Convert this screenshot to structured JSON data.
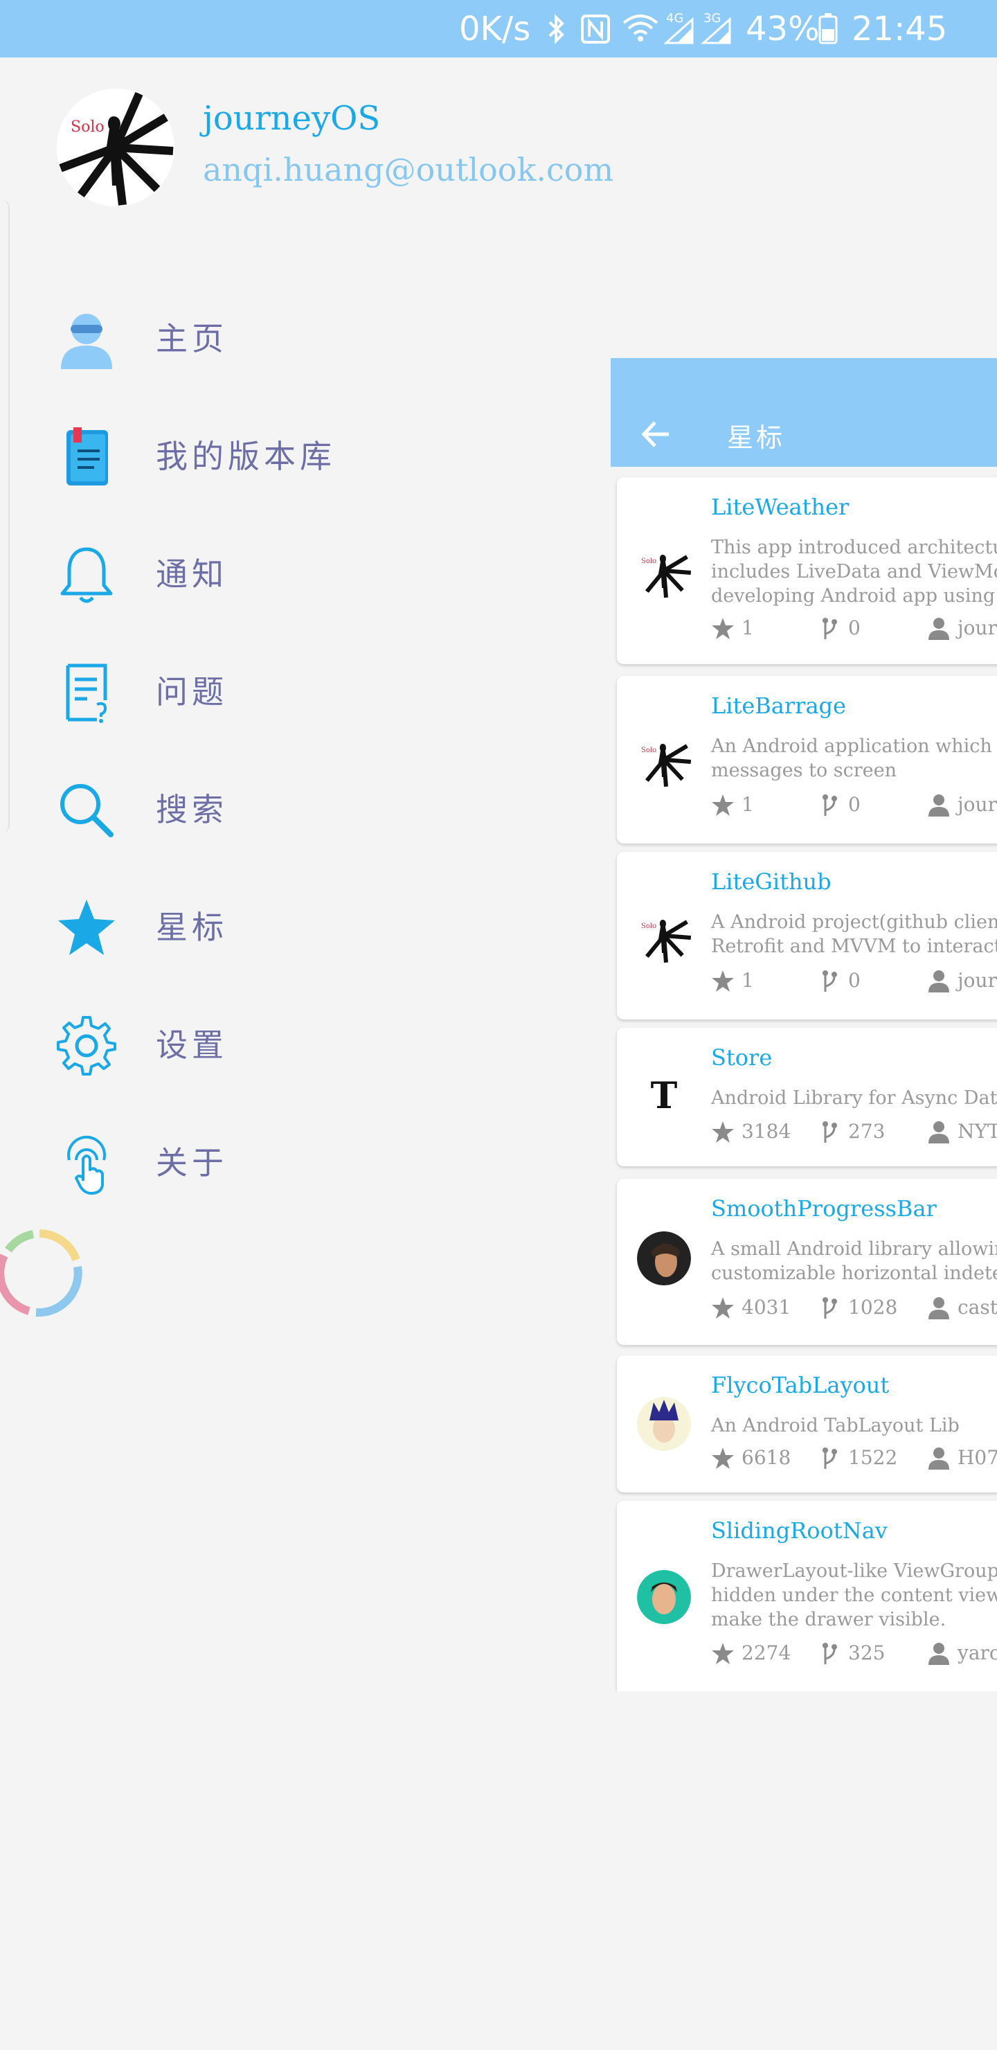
{
  "status_bar": {
    "speed": "0K/s",
    "network_4g": "4G",
    "network_3g": "3G",
    "battery": "43%",
    "time": "21:45"
  },
  "drawer": {
    "user_name": "journeyOS",
    "user_email": "anqi.huang@outlook.com",
    "menu": [
      {
        "label": "主页",
        "icon": "user-icon"
      },
      {
        "label": "我的版本库",
        "icon": "book-icon"
      },
      {
        "label": "通知",
        "icon": "bell-icon"
      },
      {
        "label": "问题",
        "icon": "issue-icon"
      },
      {
        "label": "搜索",
        "icon": "search-icon"
      },
      {
        "label": "星标",
        "icon": "star-icon"
      },
      {
        "label": "设置",
        "icon": "gear-icon"
      },
      {
        "label": "关于",
        "icon": "touch-icon"
      }
    ]
  },
  "starred": {
    "title": "星标",
    "repos": [
      {
        "name": "LiteWeather",
        "desc": [
          "This app introduced architecture",
          "includes LiveData and ViewMode",
          "developing Android app using MV"
        ],
        "stars": "1",
        "forks": "0",
        "owner": "jour"
      },
      {
        "name": "LiteBarrage",
        "desc": [
          "An Android application which allo",
          "messages to screen"
        ],
        "stars": "1",
        "forks": "0",
        "owner": "jour"
      },
      {
        "name": "LiteGithub",
        "desc": [
          "A Android project(github client)",
          "Retrofit and MVVM to interact v"
        ],
        "stars": "1",
        "forks": "0",
        "owner": "jour"
      },
      {
        "name": "Store",
        "desc": [
          "Android Library for Async Data"
        ],
        "stars": "3184",
        "forks": "273",
        "owner": "NYT"
      },
      {
        "name": "SmoothProgressBar",
        "desc": [
          "A small Android library allowing",
          "customizable horizontal indeterm"
        ],
        "stars": "4031",
        "forks": "1028",
        "owner": "caste"
      },
      {
        "name": "FlycoTabLayout",
        "desc": [
          "An Android TabLayout Lib"
        ],
        "stars": "6618",
        "forks": "1522",
        "owner": "H07"
      },
      {
        "name": "SlidingRootNav",
        "desc": [
          "DrawerLayout-like ViewGroup, v",
          "hidden under the content view, v",
          "make the drawer visible."
        ],
        "stars": "2274",
        "forks": "325",
        "owner": "yaro"
      }
    ]
  }
}
